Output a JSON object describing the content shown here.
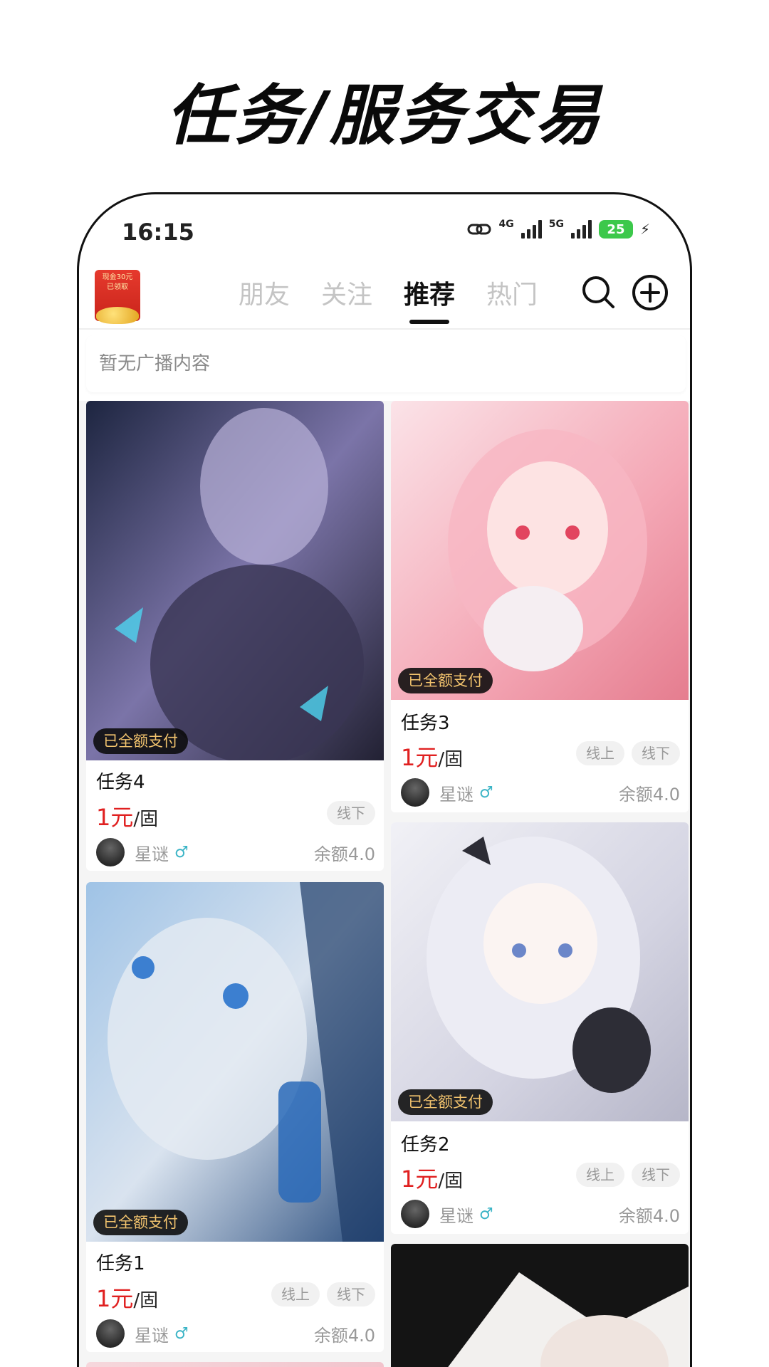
{
  "promo": {
    "title": "任务/服务交易"
  },
  "status_bar": {
    "time": "16:15",
    "network_1": "4G",
    "network_2": "5G",
    "battery": "25"
  },
  "header": {
    "coin_badge_line1": "现金30元",
    "coin_badge_line2": "已领取",
    "tabs": [
      {
        "label": "朋友"
      },
      {
        "label": "关注"
      },
      {
        "label": "推荐",
        "active": true
      },
      {
        "label": "热门"
      }
    ]
  },
  "broadcast": {
    "text": "暂无广播内容"
  },
  "colors": {
    "price": "#e02020",
    "badge_text": "#f3c46e",
    "accent": "#111111"
  },
  "cards": [
    {
      "title": "任务4",
      "badge": "已全额支付",
      "price_amount": "1元",
      "price_unit": "/固",
      "tags": [
        "线下"
      ],
      "user": "星谜",
      "gender_icon": "♂",
      "balance": "余额4.0"
    },
    {
      "title": "任务3",
      "badge": "已全额支付",
      "price_amount": "1元",
      "price_unit": "/固",
      "tags": [
        "线上",
        "线下"
      ],
      "user": "星谜",
      "gender_icon": "♂",
      "balance": "余额4.0"
    },
    {
      "title": "任务1",
      "badge": "已全额支付",
      "price_amount": "1元",
      "price_unit": "/固",
      "tags": [
        "线上",
        "线下"
      ],
      "user": "星谜",
      "gender_icon": "♂",
      "balance": "余额4.0"
    },
    {
      "title": "任务2",
      "badge": "已全额支付",
      "price_amount": "1元",
      "price_unit": "/固",
      "tags": [
        "线上",
        "线下"
      ],
      "user": "星谜",
      "gender_icon": "♂",
      "balance": "余额4.0"
    }
  ]
}
